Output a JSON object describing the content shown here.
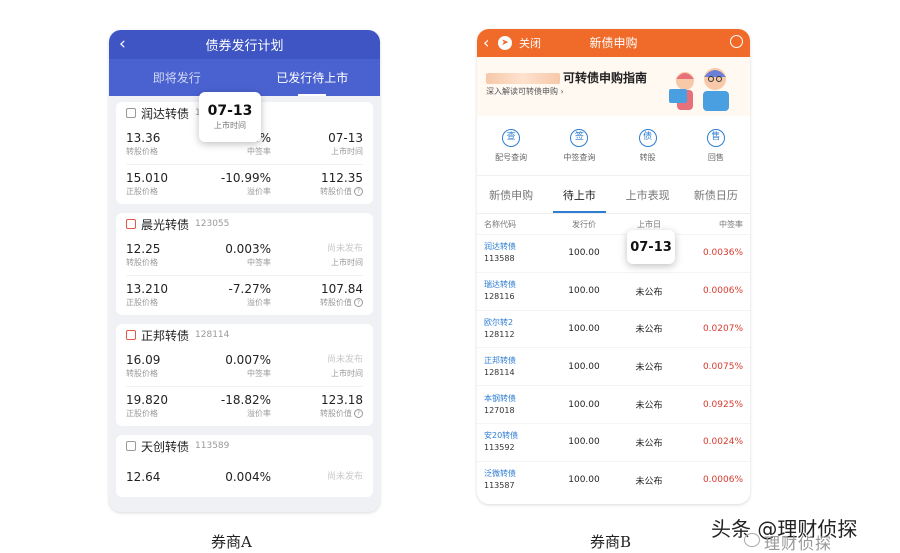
{
  "phone_a": {
    "title": "债券发行计划",
    "back": "‹",
    "tabs": [
      "即将发行",
      "已发行待上市"
    ],
    "cards": [
      {
        "name": "润达转债",
        "code": "113588",
        "row1": {
          "v1": "13.36",
          "l1": "转股价格",
          "v2": "0.004%",
          "l2": "中签率",
          "v3": "07-13",
          "l3": "上市时间"
        },
        "row2": {
          "v1": "15.010",
          "l1": "正股价格",
          "v2": "-10.99%",
          "l2": "溢价率",
          "v3": "112.35",
          "l3": "转股价值"
        }
      },
      {
        "name": "晨光转债",
        "code": "123055",
        "row1": {
          "v1": "12.25",
          "l1": "转股价格",
          "v2": "0.003%",
          "l2": "中签率",
          "v3": "尚未发布",
          "l3": "上市时间"
        },
        "row2": {
          "v1": "13.210",
          "l1": "正股价格",
          "v2": "-7.27%",
          "l2": "溢价率",
          "v3": "107.84",
          "l3": "转股价值"
        }
      },
      {
        "name": "正邦转债",
        "code": "128114",
        "row1": {
          "v1": "16.09",
          "l1": "转股价格",
          "v2": "0.007%",
          "l2": "中签率",
          "v3": "尚未发布",
          "l3": "上市时间"
        },
        "row2": {
          "v1": "19.820",
          "l1": "正股价格",
          "v2": "-18.82%",
          "l2": "溢价率",
          "v3": "123.18",
          "l3": "转股价值"
        }
      },
      {
        "name": "天创转债",
        "code": "113589",
        "row1": {
          "v1": "12.64",
          "l1": "",
          "v2": "0.004%",
          "l2": "",
          "v3": "尚未发布",
          "l3": ""
        }
      }
    ],
    "highlight": {
      "value": "07-13",
      "label": "上市时间"
    }
  },
  "phone_b": {
    "close": "关闭",
    "title": "新债申购",
    "banner_title": "可转债申购指南",
    "banner_sub": "深入解读可转债申购 ›",
    "icons": [
      {
        "icon": "查",
        "label": "配号查询"
      },
      {
        "icon": "签",
        "label": "中签查询"
      },
      {
        "icon": "债",
        "label": "转股"
      },
      {
        "icon": "售",
        "label": "回售"
      }
    ],
    "tabs": [
      "新债申购",
      "待上市",
      "上市表现",
      "新债日历"
    ],
    "headers": [
      "名称代码",
      "发行价",
      "上市日",
      "中签率"
    ],
    "rows": [
      {
        "name": "润达转债",
        "code": "113588",
        "price": "100.00",
        "date": "07-13",
        "rate": "0.0036%"
      },
      {
        "name": "瑞达转债",
        "code": "128116",
        "price": "100.00",
        "date": "未公布",
        "rate": "0.0006%"
      },
      {
        "name": "欧尔转2",
        "code": "128112",
        "price": "100.00",
        "date": "未公布",
        "rate": "0.0207%"
      },
      {
        "name": "正邦转债",
        "code": "128114",
        "price": "100.00",
        "date": "未公布",
        "rate": "0.0075%"
      },
      {
        "name": "本钢转债",
        "code": "127018",
        "price": "100.00",
        "date": "未公布",
        "rate": "0.0925%"
      },
      {
        "name": "安20转债",
        "code": "113592",
        "price": "100.00",
        "date": "未公布",
        "rate": "0.0024%"
      },
      {
        "name": "泛微转债",
        "code": "113587",
        "price": "100.00",
        "date": "未公布",
        "rate": "0.0006%"
      }
    ],
    "highlight": "07-13"
  },
  "captions": {
    "a": "券商A",
    "b": "券商B"
  },
  "watermark": {
    "main": "头条 @理财侦探",
    "sub": "理财侦探"
  },
  "colors": {
    "a_header": "#3f55c4",
    "b_header": "#f06b2a",
    "link_blue": "#2d7dd2",
    "rate_red": "#d93a2e"
  }
}
